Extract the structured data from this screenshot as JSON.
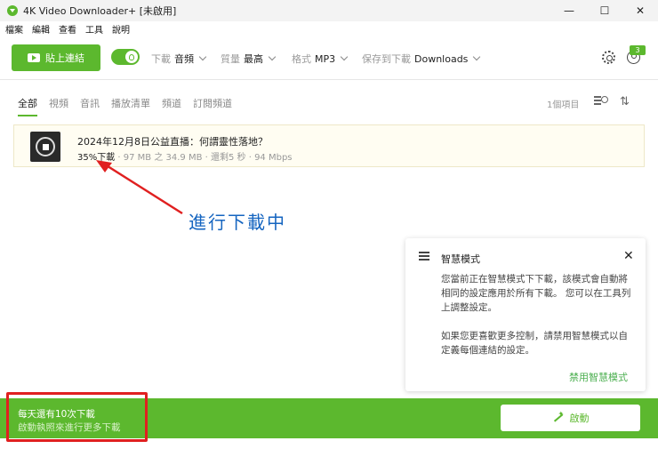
{
  "window": {
    "title": "4K Video Downloader+ [未啟用]",
    "controls": [
      "—",
      "☐",
      "✕"
    ]
  },
  "menu": [
    "檔案",
    "編輯",
    "查看",
    "工具",
    "說明"
  ],
  "toolbar": {
    "paste_label": "貼上連結",
    "download_label": "下載",
    "download_value": "音頻",
    "quality_label": "質量",
    "quality_value": "最高",
    "format_label": "格式",
    "format_value": "MP3",
    "save_label": "保存到下載",
    "save_value": "Downloads",
    "badge_count": "3"
  },
  "tabs": [
    "全部",
    "視頻",
    "音訊",
    "播放清單",
    "頻道",
    "訂閱頻道"
  ],
  "items_count": "1個項目",
  "download": {
    "title": "2024年12月8日公益直播：何謂靈性落地？",
    "percent": "35%",
    "status_word": "下載",
    "details": " · 97 MB 之 34.9 MB · 還剩5 秒 · 94 Mbps",
    "progress": 0.35
  },
  "annotation": {
    "text": "進行下載中",
    "color": "#1565c0"
  },
  "smart_mode": {
    "title": "智慧模式",
    "para1": "您當前正在智慧模式下下載，該模式會自動將相同的設定應用於所有下載。 您可以在工具列上調整設定。",
    "para2": "如果您更喜歡更多控制，請禁用智慧模式以自定義每個連結的設定。",
    "disable_link": "禁用智慧模式"
  },
  "bottom": {
    "line1": "每天還有10次下載",
    "line2": "啟動執照來進行更多下載",
    "activate_label": "啟動"
  },
  "colors": {
    "accent": "#5cb82e",
    "highlight": "#e02020"
  }
}
